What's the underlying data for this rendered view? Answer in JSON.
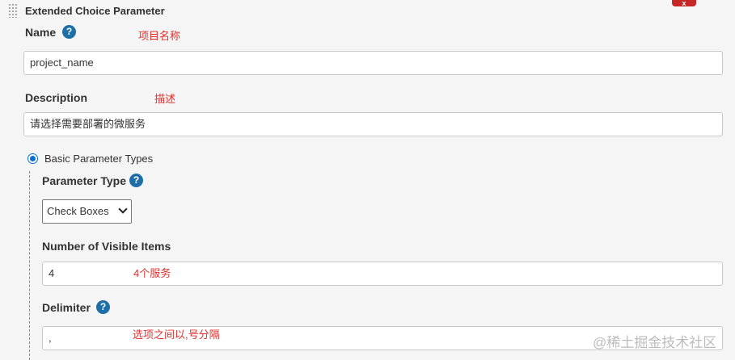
{
  "section": {
    "title": "Extended Choice Parameter",
    "delete_label": "x"
  },
  "name": {
    "label": "Name",
    "help": "?",
    "annotation": "项目名称",
    "value": "project_name"
  },
  "description": {
    "label": "Description",
    "annotation": "描述",
    "value": "请选择需要部署的微服务"
  },
  "parameter_type_group": {
    "radio_label": "Basic Parameter Types",
    "selected": true
  },
  "parameter_type": {
    "label": "Parameter Type",
    "help": "?",
    "selected": "Check Boxes"
  },
  "visible_items": {
    "label": "Number of Visible Items",
    "value": "4",
    "annotation": "4个服务"
  },
  "delimiter": {
    "label": "Delimiter",
    "help": "?",
    "value": ",",
    "annotation": "选项之间以,号分隔"
  },
  "watermark": "@稀土掘金技术社区",
  "colors": {
    "annotation": "#e0302d",
    "help_icon": "#1e6fa8",
    "radio": "#0a6fd1",
    "delete_button": "#c62828"
  }
}
